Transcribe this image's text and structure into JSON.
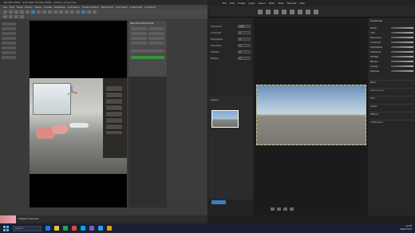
{
  "max": {
    "title": "3ds Max 2020 - Autodesk 3ds Max 2020 - interior_scene.max",
    "menus": [
      "File",
      "Edit",
      "Tools",
      "Group",
      "Views",
      "Create",
      "Modifiers",
      "Animation",
      "Graph Editors",
      "Rendering",
      "Civil View",
      "Customize",
      "Scripting",
      "Interactive",
      "Content",
      "Arnold",
      "Help"
    ],
    "command_panel_title": "Standard Primitives",
    "status": "1 Object Selected",
    "viewport_label": "[+] [Camera001] [Standard] [Default Shading]"
  },
  "ps": {
    "menus": [
      "File",
      "Edit",
      "Image",
      "Layer",
      "Select",
      "Filter",
      "View",
      "Window",
      "Help"
    ],
    "left_panel": [
      {
        "label": "Exposure",
        "value": "0.00"
      },
      {
        "label": "Contrast",
        "value": "0"
      },
      {
        "label": "Highlights",
        "value": "0"
      },
      {
        "label": "Shadows",
        "value": "0"
      },
      {
        "label": "Whites",
        "value": "0"
      },
      {
        "label": "Blacks",
        "value": "0"
      }
    ],
    "thumb_panel_title": "Layers",
    "right_panel_title": "Properties",
    "right_sections": [
      "Basic",
      "Tone Curve",
      "HSL",
      "Detail",
      "Effects",
      "Calibration"
    ],
    "right_sliders": [
      "Temp",
      "Tint",
      "Exposure",
      "Contrast",
      "Highlights",
      "Shadows",
      "Whites",
      "Blacks",
      "Clarity",
      "Dehaze"
    ]
  },
  "taskbar": {
    "search_placeholder": "Search",
    "time": "12:30",
    "date": "2021/03/15",
    "icon_colors": [
      "#1b7bd6",
      "#f2c037",
      "#2aa24a",
      "#d94a3a",
      "#00a4ef",
      "#7d5cc5",
      "#1ca1f2",
      "#e0a000"
    ]
  }
}
